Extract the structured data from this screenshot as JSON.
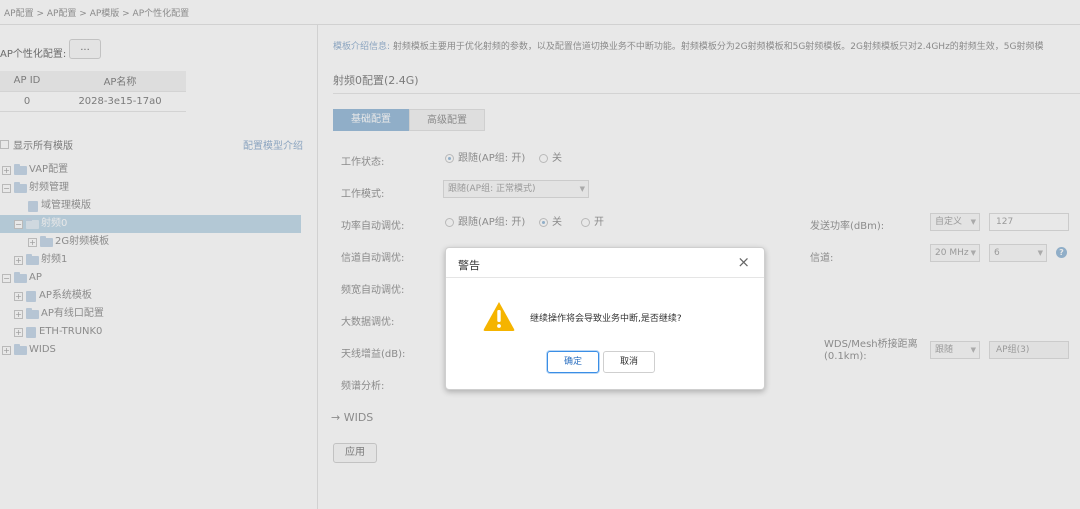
{
  "breadcrumb": "AP配置 > AP配置 > AP模版 > AP个性化配置",
  "left": {
    "personalization_label": "AP个性化配置:",
    "personalization_button": "...",
    "table": {
      "headers": [
        "AP ID",
        "AP名称"
      ],
      "rows": [
        [
          "0",
          "2028-3e15-17a0"
        ]
      ]
    },
    "show_all_label": "显示所有模版",
    "intro_link": "配置模型介绍",
    "tree": [
      {
        "label": "VAP配置",
        "icon": "folder-icon",
        "toggle": "+"
      },
      {
        "label": "射频管理",
        "icon": "folder-icon",
        "toggle": "−"
      },
      {
        "label": "域管理模版",
        "icon": "document-icon",
        "toggle": ""
      },
      {
        "label": "射频0",
        "icon": "folder-icon",
        "toggle": "−"
      },
      {
        "label": "2G射频模板",
        "icon": "folder-icon",
        "toggle": "+"
      },
      {
        "label": "射频1",
        "icon": "folder-icon",
        "toggle": "+"
      },
      {
        "label": "AP",
        "icon": "folder-icon",
        "toggle": "−"
      },
      {
        "label": "AP系统模板",
        "icon": "document-icon",
        "toggle": "+"
      },
      {
        "label": "AP有线口配置",
        "icon": "folder-icon",
        "toggle": "+"
      },
      {
        "label": "ETH-TRUNK0",
        "icon": "document-icon",
        "toggle": "+"
      },
      {
        "label": "WIDS",
        "icon": "folder-icon",
        "toggle": "+"
      }
    ]
  },
  "right": {
    "info_key": "模板介绍信息:",
    "info_text": " 射频模板主要用于优化射频的参数，以及配置信道切换业务不中断功能。射频模板分为2G射频模板和5G射频模板。2G射频模板只对2.4GHz的射频生效，5G射频模",
    "section_title": "射频0配置(2.4G)",
    "tabs": [
      {
        "label": "基础配置",
        "active": true
      },
      {
        "label": "高级配置",
        "active": false
      }
    ],
    "fields": {
      "work_status": {
        "label": "工作状态:",
        "opt1": "跟随(AP组: 开)",
        "opt2": "关"
      },
      "work_mode": {
        "label": "工作模式:",
        "value": "跟随(AP组: 正常模式)"
      },
      "power_auto": {
        "label": "功率自动调优:",
        "opt1": "跟随(AP组: 开)",
        "opt2": "关",
        "opt3": "开"
      },
      "channel_auto": {
        "label": "信道自动调优:"
      },
      "bandwidth_auto": {
        "label": "频宽自动调优:"
      },
      "bigdata": {
        "label": "大数据调优:"
      },
      "antenna_gain": {
        "label": "天线增益(dB):"
      },
      "spectrum": {
        "label": "频谱分析:"
      },
      "tx_power": {
        "label": "发送功率(dBm):",
        "mode": "自定义",
        "value": "127"
      },
      "channel": {
        "label": "信道:",
        "bw": "20 MHz",
        "ch": "6"
      },
      "wds_distance": {
        "label": "WDS/Mesh桥接距离(0.1km):",
        "mode": "跟随",
        "placeholder": "AP组(3)"
      }
    },
    "wids_label": "WIDS",
    "apply_button": "应用"
  },
  "dialog": {
    "title": "警告",
    "message": "继续操作将会导致业务中断,是否继续?",
    "ok": "确定",
    "cancel": "取消",
    "warn_color": "#f5b400"
  }
}
